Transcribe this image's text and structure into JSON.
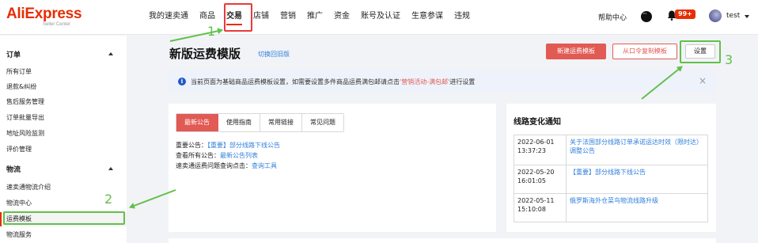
{
  "header": {
    "logo_main": "AliExpress",
    "logo_sub": "Seller Center",
    "nav": [
      "我的速卖通",
      "商品",
      "交易",
      "店铺",
      "营销",
      "推广",
      "资金",
      "账号及认证",
      "生意参谋",
      "违规"
    ],
    "active_nav": "交易",
    "help": "帮助中心",
    "badge": "99+",
    "user": "test",
    "icons": [
      "chat-icon",
      "bell-icon",
      "avatar",
      "caret-down-icon"
    ]
  },
  "sidebar": {
    "sections": [
      {
        "title": "订单",
        "items": [
          "所有订单",
          "退款&纠纷",
          "售后服务管理",
          "订单批量导出",
          "地址风险监测",
          "评价管理"
        ]
      },
      {
        "title": "物流",
        "items": [
          "速卖通物流介绍",
          "物流中心",
          "运费模板",
          "物流服务"
        ]
      }
    ],
    "active_item": "运费模板"
  },
  "main": {
    "title": "新版运费模版",
    "switch_link": "切换回旧版",
    "buttons": {
      "new": "新建运费模板",
      "copy": "从口令复制模板",
      "settings": "设置"
    },
    "info": {
      "text_before": "当前页面为基础商品运费模板设置，如需要设置多件商品运费满包邮请点击",
      "link": "'营销活动-满包邮'",
      "text_after": "进行设置",
      "close": "×"
    },
    "tabs": [
      "最新公告",
      "使用指南",
      "常用链接",
      "常见问题"
    ],
    "active_tab": "最新公告",
    "notices": [
      {
        "label": "重要公告：",
        "link": "【重要】部分线路下线公告"
      },
      {
        "label": "查看所有公告：",
        "link": "最新公告列表"
      },
      {
        "label": "速卖通运费问题查询点击：",
        "link": "查询工具"
      }
    ],
    "route_card": {
      "title": "线路变化通知",
      "rows": [
        {
          "date": "2022-06-01 13:37:23",
          "title": "关于法国部分线路订单承诺运达时效（限时达）调整公告"
        },
        {
          "date": "2022-05-20 16:01:05",
          "title": "【重要】部分线路下线公告"
        },
        {
          "date": "2022-05-11 15:10:08",
          "title": "俄罗斯海外仓菜鸟物流线路升级"
        }
      ]
    }
  },
  "annotations": [
    "1",
    "2",
    "3"
  ],
  "colors": {
    "brand": "#e62e04",
    "primary_button": "#e25a54",
    "link": "#2f7fdc",
    "annotation": "#62c04a",
    "highlight_red": "#e83a3a"
  }
}
